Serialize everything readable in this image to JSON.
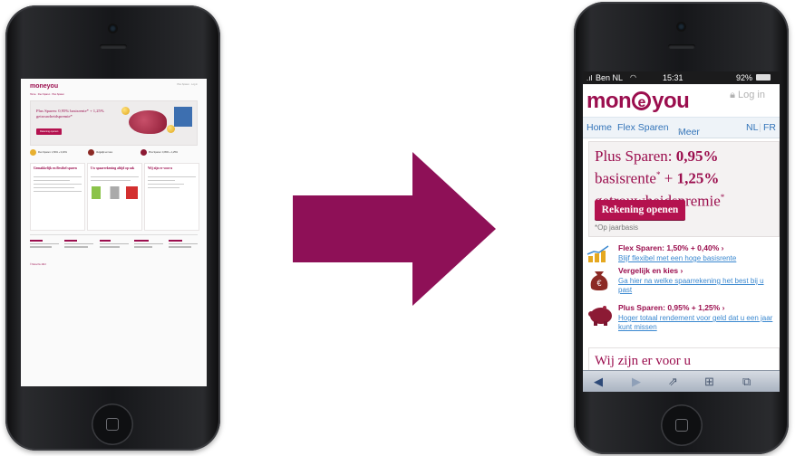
{
  "colors": {
    "brand": "#9b0e4e",
    "button": "#b4124f",
    "link": "#3a88d0",
    "arrow": "#8e1057"
  },
  "left_phone": {
    "logo": "moneyou",
    "util": "Plus Sparen  ·  Log in",
    "nav": [
      "Home",
      "Flex Sparen",
      "Plus Sparen"
    ],
    "hero_title": "Plus Sparen: 0,95% basisrente* + 1,25% getrouwheidspremie*",
    "hero_button": "Rekening openen",
    "promos": [
      "Flex Sparen: 1,50% + 0,40%",
      "Vergelijk en kies",
      "Plus Sparen: 0,95% + 1,25%"
    ],
    "columns": [
      "Gemakkelijk en flexibel sparen",
      "Uw spaarrekening altijd op zak",
      "Wij zijn er voor u"
    ],
    "footer_copyright": "© MoneYou 2013"
  },
  "right_phone": {
    "status": {
      "carrier": "Ben NL",
      "time": "15:31",
      "battery": "92%"
    },
    "logo_pre": "mon",
    "logo_at": "e",
    "logo_post": "you",
    "login": "Log in",
    "nav": {
      "home": "Home",
      "flex": "Flex Sparen",
      "more": "Meer",
      "nl": "NL",
      "fr": "FR"
    },
    "hero": {
      "line1": "Plus Sparen: ",
      "rate1": "0,95%",
      "line2": "basisrente",
      "plus": " + ",
      "rate2": "1,25%",
      "line3": "getrouwheidspremie",
      "star": "*",
      "button": "Rekening openen",
      "footnote": "*Op jaarbasis"
    },
    "promos": [
      {
        "title": "Flex Sparen: 1,50% + 0,40% ›",
        "link": "Blijf flexibel met een hoge basisrente",
        "icon": "chart-coins-icon"
      },
      {
        "title": "Vergelijk en kies ›",
        "link": "Ga hier na welke spaarrekening het best bij u past",
        "icon": "money-bag-icon"
      },
      {
        "title": "Plus Sparen: 0,95% + 1,25% ›",
        "link": "Hoger totaal rendement voor geld dat u een jaar kunt missen",
        "icon": "piggy-bank-icon"
      }
    ],
    "card_title": "Wij zijn er voor u",
    "toolbar_icons": [
      "back-icon",
      "forward-icon",
      "share-icon",
      "bookmarks-icon",
      "tabs-icon"
    ]
  }
}
